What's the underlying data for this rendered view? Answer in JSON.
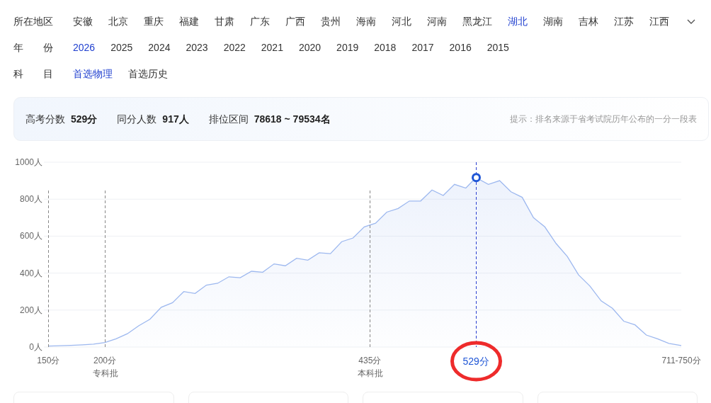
{
  "filters": [
    {
      "label": "所在地区",
      "options": [
        {
          "text": "安徽",
          "selected": false
        },
        {
          "text": "北京",
          "selected": false
        },
        {
          "text": "重庆",
          "selected": false
        },
        {
          "text": "福建",
          "selected": false
        },
        {
          "text": "甘肃",
          "selected": false
        },
        {
          "text": "广东",
          "selected": false
        },
        {
          "text": "广西",
          "selected": false
        },
        {
          "text": "贵州",
          "selected": false
        },
        {
          "text": "海南",
          "selected": false
        },
        {
          "text": "河北",
          "selected": false
        },
        {
          "text": "河南",
          "selected": false
        },
        {
          "text": "黑龙江",
          "selected": false
        },
        {
          "text": "湖北",
          "selected": true
        },
        {
          "text": "湖南",
          "selected": false
        },
        {
          "text": "吉林",
          "selected": false
        },
        {
          "text": "江苏",
          "selected": false
        },
        {
          "text": "江西",
          "selected": false
        }
      ],
      "expandable": true
    },
    {
      "label": "年份",
      "options": [
        {
          "text": "2026",
          "selected": true
        },
        {
          "text": "2025",
          "selected": false
        },
        {
          "text": "2024",
          "selected": false
        },
        {
          "text": "2023",
          "selected": false
        },
        {
          "text": "2022",
          "selected": false
        },
        {
          "text": "2021",
          "selected": false
        },
        {
          "text": "2020",
          "selected": false
        },
        {
          "text": "2019",
          "selected": false
        },
        {
          "text": "2018",
          "selected": false
        },
        {
          "text": "2017",
          "selected": false
        },
        {
          "text": "2016",
          "selected": false
        },
        {
          "text": "2015",
          "selected": false
        }
      ]
    },
    {
      "label": "科目",
      "options": [
        {
          "text": "首选物理",
          "selected": true
        },
        {
          "text": "首选历史",
          "selected": false
        }
      ]
    }
  ],
  "summary": {
    "stats": [
      {
        "label": "高考分数",
        "value": "529分"
      },
      {
        "label": "同分人数",
        "value": "917人"
      },
      {
        "label": "排位区间",
        "value": "78618 ~ 79534名"
      }
    ],
    "hint": "提示：排名来源于省考试院历年公布的一分一段表"
  },
  "chart_data": {
    "type": "area",
    "xlim": [
      146,
      711
    ],
    "ylim": [
      0,
      1000
    ],
    "grid": true,
    "yticks": [
      {
        "value": 0,
        "label": "0人"
      },
      {
        "value": 200,
        "label": "200人"
      },
      {
        "value": 400,
        "label": "400人"
      },
      {
        "value": 600,
        "label": "600人"
      },
      {
        "value": 800,
        "label": "800人"
      },
      {
        "value": 1000,
        "label": "1000人"
      }
    ],
    "xticks": [
      {
        "value": 150,
        "label": "150分"
      },
      {
        "value": 200,
        "label": "200分"
      },
      {
        "value": 435,
        "label": "435分"
      },
      {
        "value": 529,
        "label": "529分"
      },
      {
        "value": 711,
        "label": "711-750分"
      }
    ],
    "x": [
      150,
      160,
      170,
      180,
      190,
      200,
      210,
      220,
      230,
      240,
      250,
      260,
      270,
      280,
      290,
      300,
      310,
      320,
      330,
      340,
      350,
      360,
      370,
      380,
      390,
      400,
      410,
      420,
      430,
      440,
      450,
      460,
      470,
      480,
      490,
      500,
      510,
      520,
      529,
      540,
      550,
      560,
      570,
      580,
      590,
      600,
      610,
      620,
      630,
      640,
      650,
      660,
      670,
      680,
      690,
      700,
      711
    ],
    "series": [
      {
        "color": "#9db8ef",
        "values": [
          5,
          7,
          9,
          12,
          16,
          24,
          45,
          72,
          115,
          150,
          215,
          240,
          300,
          290,
          335,
          345,
          380,
          375,
          410,
          405,
          450,
          440,
          480,
          470,
          510,
          505,
          570,
          590,
          650,
          670,
          730,
          750,
          790,
          790,
          850,
          820,
          880,
          860,
          917,
          880,
          900,
          840,
          810,
          700,
          650,
          560,
          490,
          390,
          330,
          250,
          210,
          140,
          120,
          65,
          45,
          20,
          8
        ]
      }
    ],
    "ref_lines": [
      {
        "axis": "x",
        "value": 150,
        "color": "#888888"
      },
      {
        "axis": "x",
        "value": 200,
        "label": "专科批",
        "color": "#888888"
      },
      {
        "axis": "x",
        "value": 435,
        "label": "本科批",
        "color": "#888888"
      },
      {
        "axis": "x",
        "value": 529,
        "color": "#2a3fd0"
      }
    ]
  }
}
